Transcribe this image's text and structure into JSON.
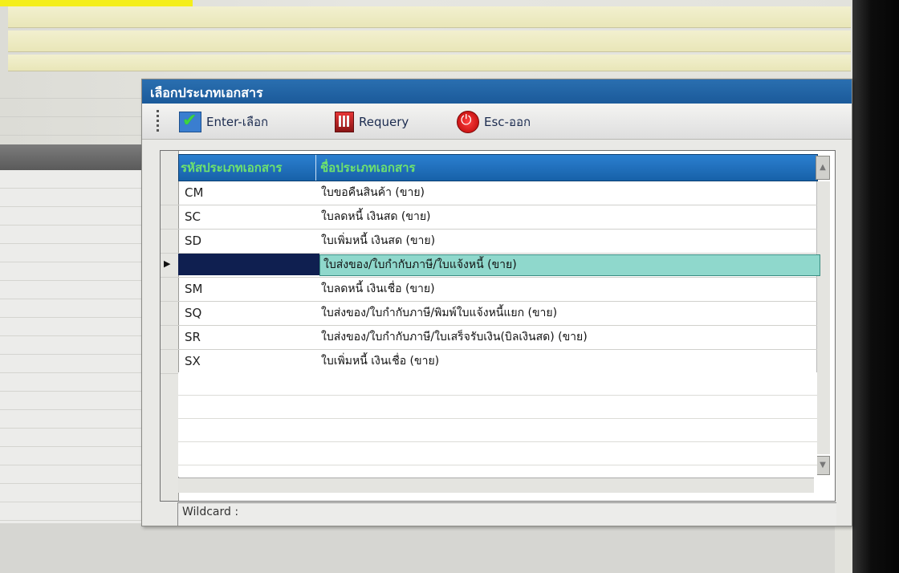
{
  "dialog": {
    "title": "เลือกประเภทเอกสาร",
    "toolbar": {
      "enter_label": "Enter-เลือก",
      "requery_label": "Requery",
      "esc_label": "Esc-ออก"
    },
    "grid": {
      "columns": [
        "รหัสประเภทเอกสาร",
        "ชื่อประเภทเอกสาร"
      ],
      "rows": [
        {
          "code": "CM",
          "name": "ใบขอคืนสินค้า (ขาย)"
        },
        {
          "code": "SC",
          "name": "ใบลดหนี้ เงินสด (ขาย)"
        },
        {
          "code": "SD",
          "name": "ใบเพิ่มหนี้ เงินสด (ขาย)"
        },
        {
          "code": "",
          "name": "ใบส่งของ/ใบกำกับภาษี/ใบแจ้งหนี้ (ขาย)"
        },
        {
          "code": "SM",
          "name": "ใบลดหนี้ เงินเชื่อ (ขาย)"
        },
        {
          "code": "SQ",
          "name": "ใบส่งของ/ใบกำกับภาษี/พิมพ์ใบแจ้งหนี้แยก (ขาย)"
        },
        {
          "code": "SR",
          "name": "ใบส่งของ/ใบกำกับภาษี/ใบเสร็จรับเงิน(บิลเงินสด) (ขาย)"
        },
        {
          "code": "SX",
          "name": "ใบเพิ่มหนี้ เงินเชื่อ (ขาย)"
        }
      ],
      "selected_index": 3
    },
    "wildcard_label": "Wildcard :"
  },
  "colors": {
    "title_bar": "#1b5a9a",
    "header": "#1761a8",
    "header_text": "#6ee26e",
    "selected_row": "#8fd8cc"
  }
}
